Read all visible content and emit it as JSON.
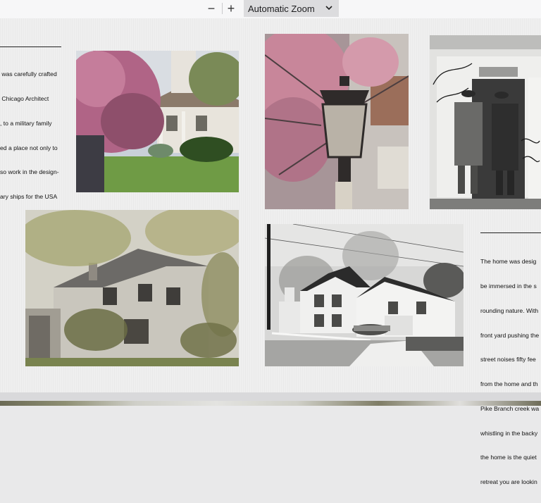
{
  "toolbar": {
    "zoom_out_label": "−",
    "zoom_in_label": "+",
    "zoom_value": "Automatic Zoom",
    "zoom_out_icon": "minus-icon",
    "zoom_in_icon": "plus-icon",
    "dropdown_icon": "chevron-down-icon"
  },
  "page": {
    "left_text": [
      " was carefully crafted",
      " Chicago Architect",
      ", to a military family",
      "ed a place not only to",
      "so work in the design-",
      "ary ships for the USA"
    ],
    "right_text": [
      "The home was desig",
      "be immersed in the s",
      "rounding nature. With",
      "front yard pushing the",
      "street noises fifty fee",
      "from the home and th",
      "Pike Branch creek wa",
      "whistling in the backy",
      "the home is the quiet",
      "retreat you are lookin"
    ]
  }
}
